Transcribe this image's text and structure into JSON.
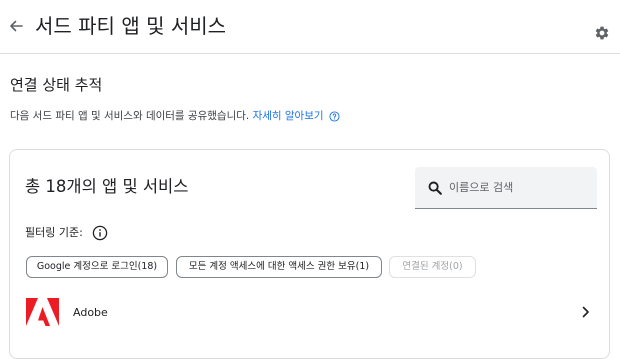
{
  "header": {
    "title": "서드 파티 앱 및 서비스"
  },
  "section": {
    "title": "연결 상태 추적",
    "description": "다음 서드 파티 앱 및 서비스와 데이터를 공유했습니다.",
    "learn_more": "자세히 알아보기"
  },
  "card": {
    "count_label": "총 18개의 앱 및 서비스",
    "search": {
      "placeholder": "이름으로 검색"
    },
    "filter_label": "필터링 기준:",
    "chips": [
      {
        "label": "Google 계정으로 로그인(18)",
        "enabled": true
      },
      {
        "label": "모든 계정 액세스에 대한 액세스 권한 보유(1)",
        "enabled": true
      },
      {
        "label": "연결된 계정(0)",
        "enabled": false
      }
    ],
    "apps": [
      {
        "name": "Adobe",
        "brand_color": "#ec1c24"
      }
    ]
  },
  "colors": {
    "link": "#1a73e8",
    "border": "#dadce0",
    "search_bg": "#f1f3f4"
  }
}
